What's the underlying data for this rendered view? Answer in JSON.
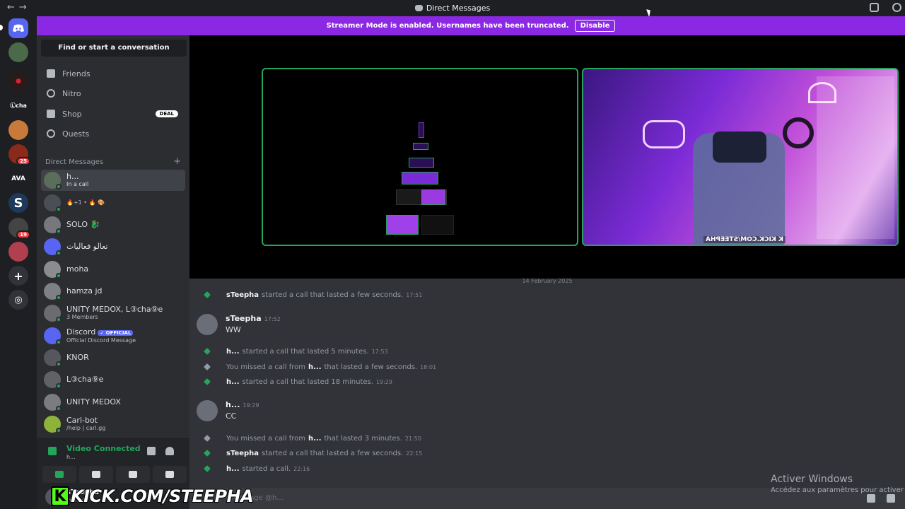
{
  "window": {
    "title": "Direct Messages"
  },
  "banner": {
    "text": "Streamer Mode is enabled. Usernames have been truncated.",
    "button": "Disable"
  },
  "sidebar": {
    "search_label": "Find or start a conversation",
    "nav": [
      {
        "label": "Friends",
        "icon": "friends-icon"
      },
      {
        "label": "Nitro",
        "icon": "nitro-icon"
      },
      {
        "label": "Shop",
        "icon": "shop-icon",
        "badge": "DEAL"
      },
      {
        "label": "Quests",
        "icon": "quests-icon"
      }
    ],
    "dm_header": "Direct Messages",
    "dm_add": "+",
    "dms": [
      {
        "name": "h...",
        "sub": "In a call",
        "active": true,
        "color": "#5a6e5a"
      },
      {
        "name": "",
        "sub": "🔥+1 • 🔥 🎨",
        "color": "#4a4f55"
      },
      {
        "name": "SOLO 🐉",
        "sub": "",
        "color": "#77787d"
      },
      {
        "name": "تعالو فعاليات",
        "sub": "",
        "color": "#5865f2"
      },
      {
        "name": "moha",
        "sub": "",
        "color": "#8a8c90"
      },
      {
        "name": "hamza jd",
        "sub": "",
        "color": "#7e8085"
      },
      {
        "name": "UNITY MEDOX, L③cha⑨e",
        "sub": "3 Members",
        "color": "#6a6c70"
      },
      {
        "name": "Discord",
        "sub": "Official Discord Message",
        "badge": "✓ OFFICIAL",
        "color": "#5865f2"
      },
      {
        "name": "KNOR",
        "sub": "",
        "color": "#55575c"
      },
      {
        "name": "L③cha⑨e",
        "sub": "",
        "color": "#606266"
      },
      {
        "name": "UNITY MEDOX",
        "sub": "",
        "color": "#7a7c80"
      },
      {
        "name": "Carl-bot",
        "sub": "/help | carl.gg",
        "color": "#8fb33a"
      }
    ]
  },
  "voice": {
    "status": "Video Connected",
    "channel": "h..."
  },
  "user": {
    "name": "sTeepha",
    "status": "In a call"
  },
  "main": {
    "date": "14 February 2025",
    "messages": [
      {
        "type": "sys",
        "kind": "call",
        "actor": "sTeepha",
        "text": "started a call that lasted a few seconds.",
        "time": "17:51"
      },
      {
        "type": "msg",
        "author": "sTeepha",
        "time": "17:52",
        "text": "WW"
      },
      {
        "type": "sys",
        "kind": "call",
        "actor": "h...",
        "text": "started a call that lasted 5 minutes.",
        "time": "17:53"
      },
      {
        "type": "sys",
        "kind": "missed",
        "pre": "You missed a call from",
        "actor": "h...",
        "text": "that lasted a few seconds.",
        "time": "18:01"
      },
      {
        "type": "sys",
        "kind": "call",
        "actor": "h...",
        "text": "started a call that lasted 18 minutes.",
        "time": "19:29"
      },
      {
        "type": "msg",
        "author": "h...",
        "time": "19:29",
        "text": "CC"
      },
      {
        "type": "sys",
        "kind": "missed",
        "pre": "You missed a call from",
        "actor": "h...",
        "text": "that lasted 3 minutes.",
        "time": "21:50"
      },
      {
        "type": "sys",
        "kind": "call",
        "actor": "sTeepha",
        "text": "started a call that lasted a few seconds.",
        "time": "22:15"
      },
      {
        "type": "sys",
        "kind": "call",
        "actor": "h...",
        "text": "started a call.",
        "time": "22:16"
      }
    ],
    "composer_placeholder": "Message @h..."
  },
  "tile_right_watermark": "K KICK.COM/STEEPHA",
  "activation": {
    "title": "Activer Windows",
    "sub": "Accédez aux paramètres pour activer Wi"
  },
  "overlay": {
    "kick_letter": "K",
    "kick_text": "KICK.COM/STEEPHA"
  }
}
